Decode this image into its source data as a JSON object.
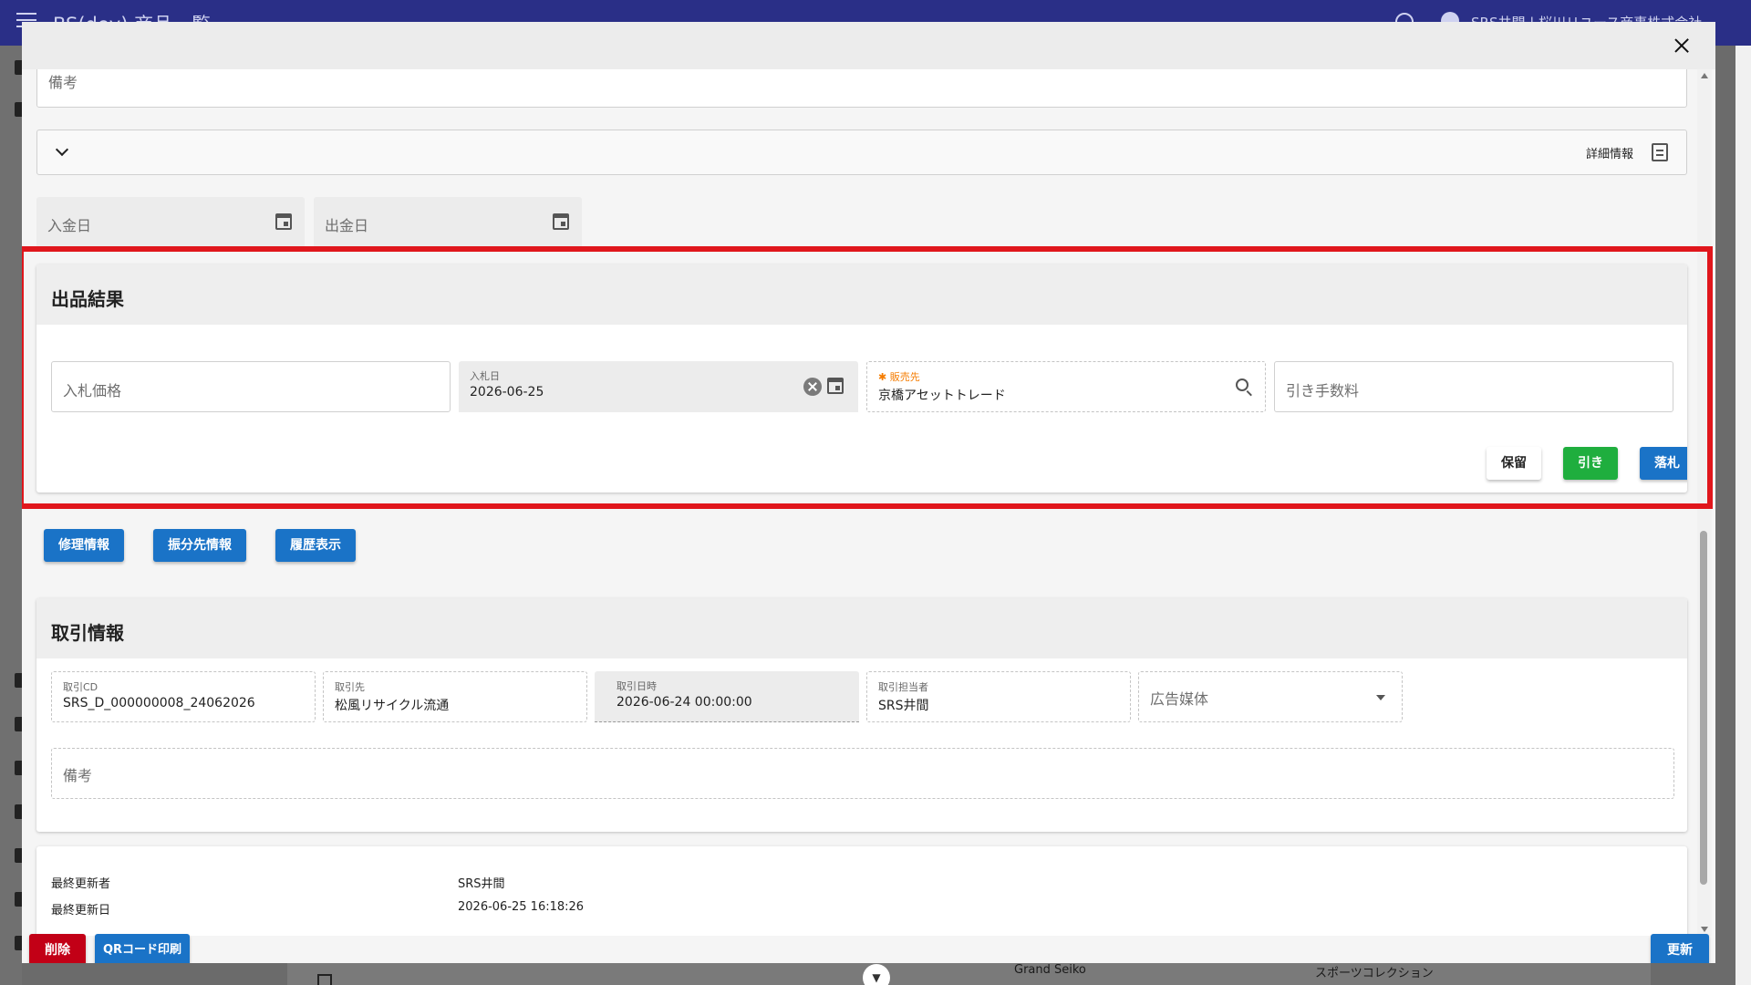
{
  "app": {
    "title": "BS(dev) 商品一覧",
    "company": "SRS井間 | 桜川リユース商事株式会社"
  },
  "background_table": {
    "brand": "Grand Seiko",
    "collection": "スポーツコレクション"
  },
  "top_section": {
    "remarks_placeholder": "備考",
    "details_label": "詳細情報",
    "deposit_date_placeholder": "入金日",
    "withdrawal_date_placeholder": "出金日"
  },
  "listing_result": {
    "title": "出品結果",
    "bid_price_placeholder": "入札価格",
    "bid_date_label": "入札日",
    "bid_date_value": "2026-06-25",
    "required_mark": "✱",
    "buyer_label": "販売先",
    "buyer_value": "京橋アセットトレード",
    "withdrawal_fee_placeholder": "引き手数料",
    "hold_label": "保留",
    "withdraw_label": "引き",
    "award_label": "落札"
  },
  "action_buttons": {
    "repair_label": "修理情報",
    "allocation_label": "振分先情報",
    "history_label": "履歴表示"
  },
  "transaction": {
    "title": "取引情報",
    "cd_label": "取引CD",
    "cd_value": "SRS_D_000000008_24062026",
    "partner_label": "取引先",
    "partner_value": "松風リサイクル流通",
    "datetime_label": "取引日時",
    "datetime_value": "2026-06-24 00:00:00",
    "staff_label": "取引担当者",
    "staff_value": "SRS井間",
    "media_placeholder": "広告媒体",
    "remarks_placeholder": "備考"
  },
  "last_update": {
    "updater_label": "最終更新者",
    "updater_value": "SRS井間",
    "date_label": "最終更新日",
    "date_value": "2026-06-25 16:18:26"
  },
  "footer": {
    "delete_label": "削除",
    "qr_label": "QRコード印刷",
    "update_label": "更新"
  },
  "colors": {
    "primary": "#1a73c7",
    "success": "#1fae3e",
    "danger": "#c20016",
    "highlight": "#e0161c",
    "header": "#2a2f87",
    "required": "#f57c00"
  }
}
